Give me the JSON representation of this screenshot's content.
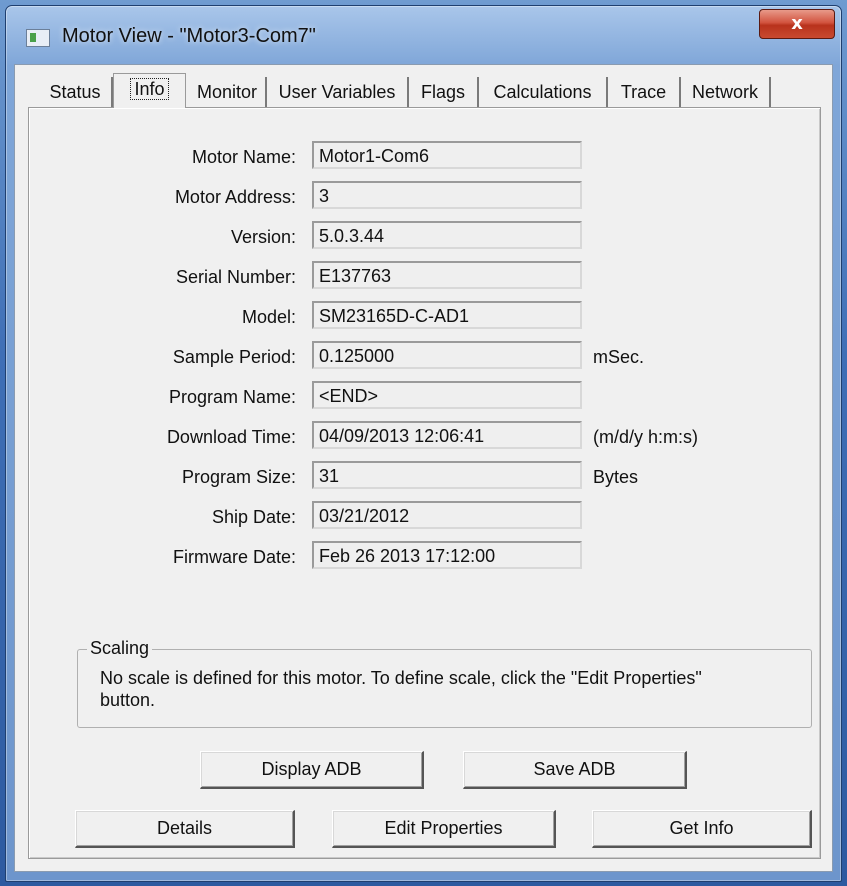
{
  "window": {
    "title": "Motor View - \"Motor3-Com7\"",
    "close_label": "x"
  },
  "tabs": [
    {
      "label": "Status"
    },
    {
      "label": "Info",
      "active": true
    },
    {
      "label": "Monitor"
    },
    {
      "label": "User Variables"
    },
    {
      "label": "Flags"
    },
    {
      "label": "Calculations"
    },
    {
      "label": "Trace"
    },
    {
      "label": "Network"
    }
  ],
  "fields": [
    {
      "label": "Motor Name:",
      "value": "Motor1-Com6",
      "unit": ""
    },
    {
      "label": "Motor Address:",
      "value": "3",
      "unit": ""
    },
    {
      "label": "Version:",
      "value": "5.0.3.44",
      "unit": ""
    },
    {
      "label": "Serial Number:",
      "value": "E137763",
      "unit": ""
    },
    {
      "label": "Model:",
      "value": "SM23165D-C-AD1",
      "unit": ""
    },
    {
      "label": "Sample Period:",
      "value": "0.125000",
      "unit": "mSec."
    },
    {
      "label": "Program Name:",
      "value": "<END>",
      "unit": ""
    },
    {
      "label": "Download Time:",
      "value": "04/09/2013 12:06:41",
      "unit": "(m/d/y h:m:s)"
    },
    {
      "label": "Program Size:",
      "value": "31",
      "unit": "Bytes"
    },
    {
      "label": "Ship Date:",
      "value": "03/21/2012",
      "unit": ""
    },
    {
      "label": "Firmware Date:",
      "value": "Feb 26 2013 17:12:00",
      "unit": ""
    }
  ],
  "scaling": {
    "title": "Scaling",
    "text": "No scale is defined for this motor. To define scale, click the \"Edit Properties\" button."
  },
  "buttons": {
    "display_adb": "Display ADB",
    "save_adb": "Save ADB",
    "details": "Details",
    "edit_properties": "Edit Properties",
    "get_info": "Get Info"
  }
}
